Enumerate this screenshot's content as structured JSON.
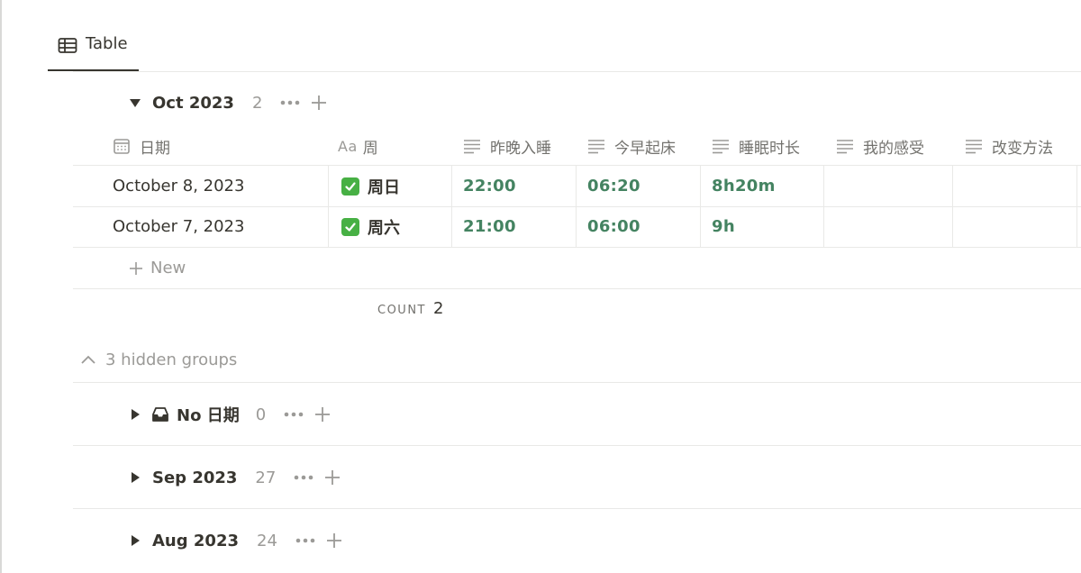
{
  "view": {
    "tab_label": "Table"
  },
  "group_open": {
    "title": "Oct 2023",
    "count": "2"
  },
  "columns": [
    {
      "label": "日期",
      "icon": "calendar-icon"
    },
    {
      "label": "周",
      "prefix": "Aa",
      "icon": "title-icon"
    },
    {
      "label": "昨晚入睡",
      "icon": "text-lines-icon"
    },
    {
      "label": "今早起床",
      "icon": "text-lines-icon"
    },
    {
      "label": "睡眠时长",
      "icon": "text-lines-icon"
    },
    {
      "label": "我的感受",
      "icon": "text-lines-icon"
    },
    {
      "label": "改变方法",
      "icon": "text-lines-icon"
    }
  ],
  "rows": [
    {
      "date": "October 8, 2023",
      "week": "周日",
      "sleep": "22:00",
      "wake": "06:20",
      "duration": "8h20m",
      "feeling": "",
      "method": ""
    },
    {
      "date": "October 7, 2023",
      "week": "周六",
      "sleep": "21:00",
      "wake": "06:00",
      "duration": "9h",
      "feeling": "",
      "method": ""
    }
  ],
  "new_label": "New",
  "count": {
    "label": "COUNT",
    "value": "2"
  },
  "hidden_groups_label": "3 hidden groups",
  "collapsed_groups": [
    {
      "title": "No 日期",
      "count": "0",
      "icon": "inbox-icon"
    },
    {
      "title": "Sep 2023",
      "count": "27"
    },
    {
      "title": "Aug 2023",
      "count": "24"
    }
  ],
  "colors": {
    "time_text": "#448361",
    "check_bg": "#47b044",
    "muted": "#9b9a97"
  }
}
